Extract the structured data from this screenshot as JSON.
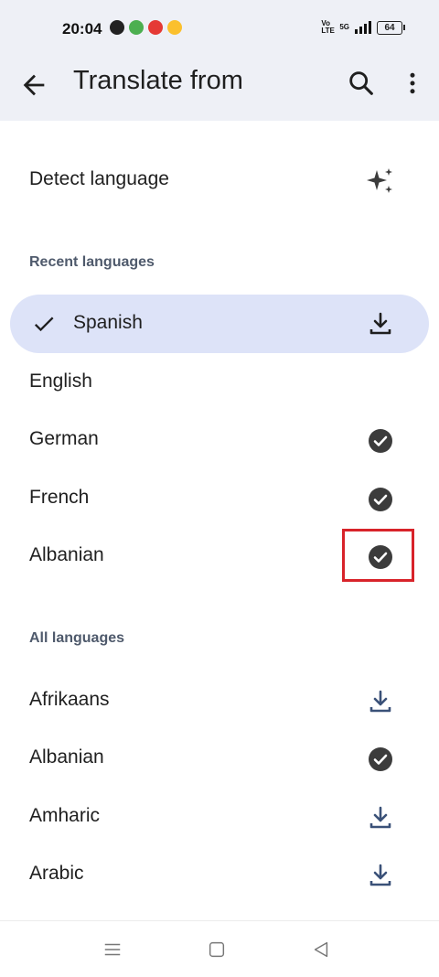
{
  "status_bar": {
    "time": "20:04",
    "volte_label": "Vo LTE",
    "network_label": "5G",
    "battery_level": "64"
  },
  "app_bar": {
    "title": "Translate from",
    "icons": [
      "back-arrow-icon",
      "search-icon",
      "more-vertical-icon"
    ]
  },
  "detect": {
    "label": "Detect language",
    "icon": "sparkle-icon"
  },
  "recent": {
    "header": "Recent languages",
    "items": [
      {
        "label": "Spanish",
        "status": "download",
        "selected": true
      },
      {
        "label": "English",
        "status": "none"
      },
      {
        "label": "German",
        "status": "downloaded"
      },
      {
        "label": "French",
        "status": "downloaded"
      },
      {
        "label": "Albanian",
        "status": "downloaded"
      }
    ]
  },
  "all": {
    "header": "All languages",
    "items": [
      {
        "label": "Afrikaans",
        "status": "download"
      },
      {
        "label": "Albanian",
        "status": "downloaded"
      },
      {
        "label": "Amharic",
        "status": "download"
      },
      {
        "label": "Arabic",
        "status": "download"
      }
    ]
  },
  "colors": {
    "selected_bg": "#dde3f8",
    "header_bg": "#eef0f6",
    "highlight": "#d8232a",
    "download_icon": "#3a5178",
    "downloaded_icon": "#3c3c3c"
  }
}
